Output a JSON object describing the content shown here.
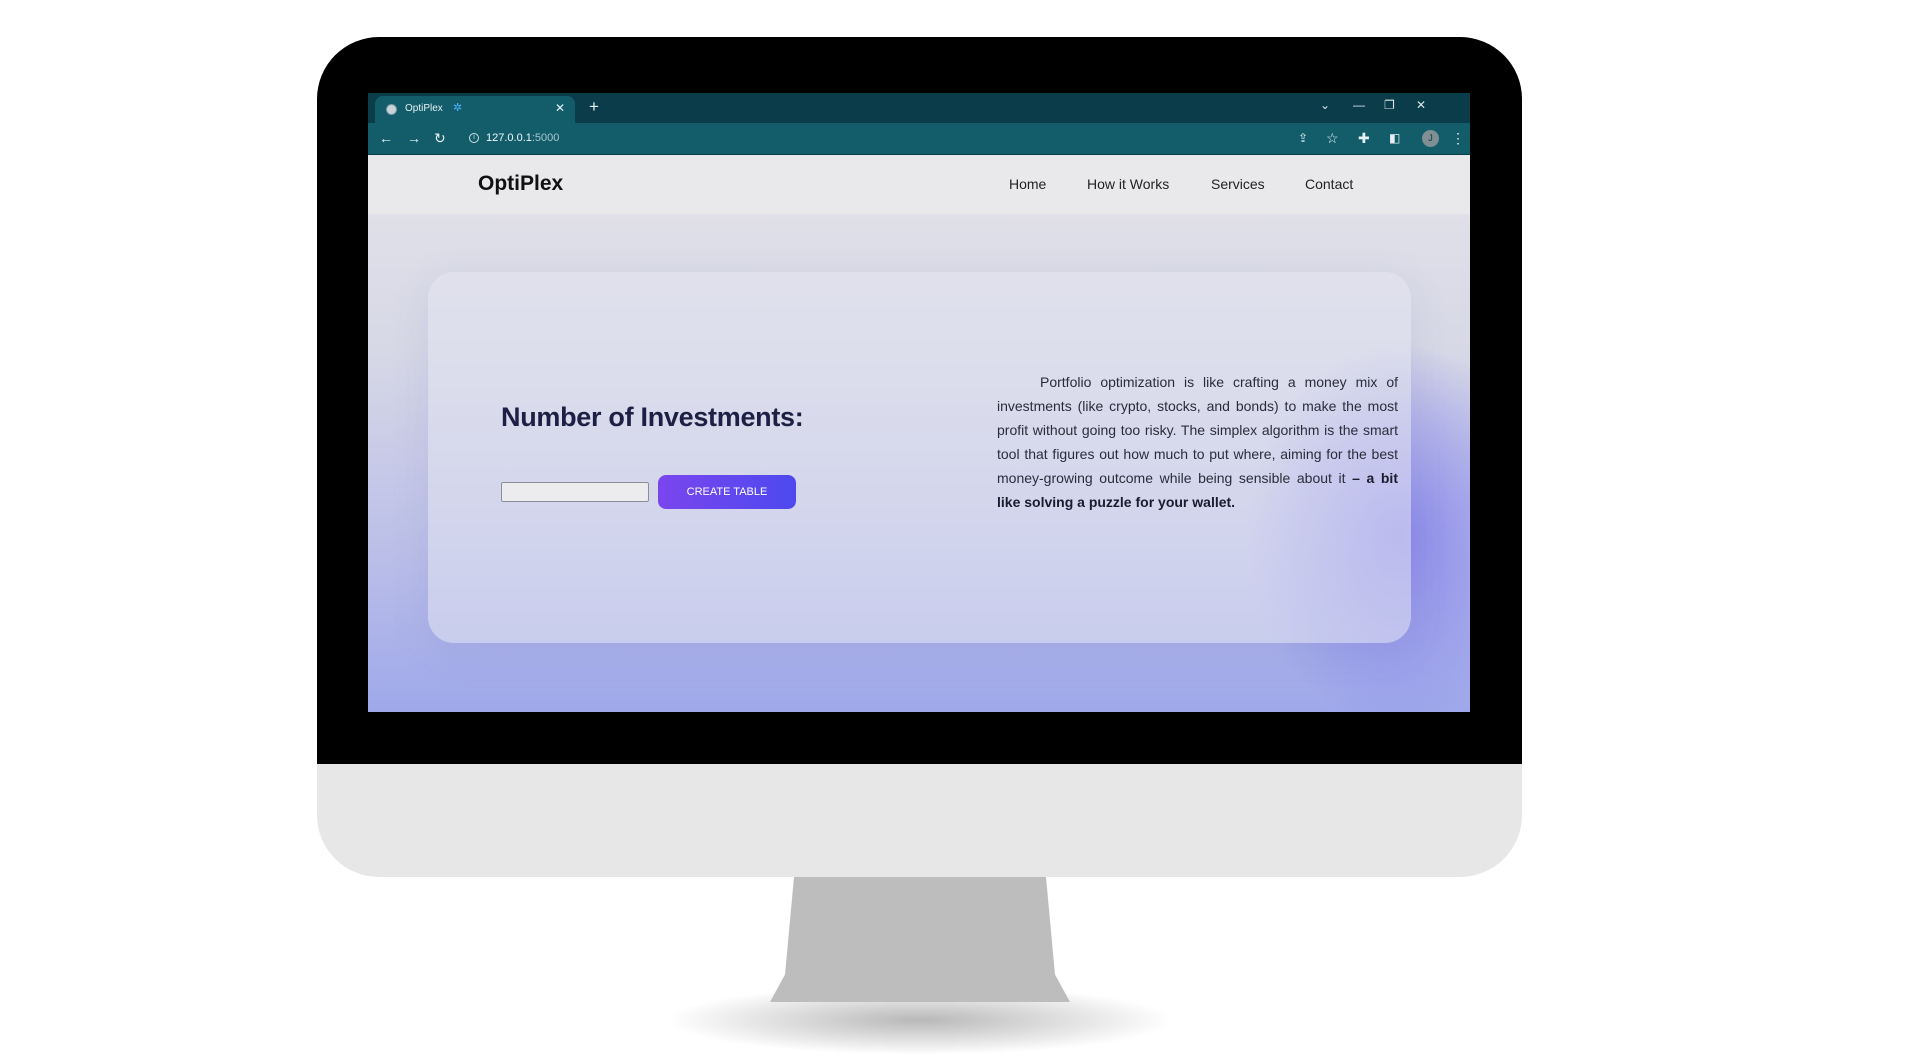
{
  "browser": {
    "tab": {
      "title": "OptiPlex",
      "close_glyph": "✕"
    },
    "new_tab_glyph": "+",
    "window_controls": [
      "⌄",
      "—",
      "❐",
      "✕"
    ],
    "url": {
      "host": "127.0.0.1",
      "port": ":5000"
    },
    "profile_initial": "J",
    "icons": [
      "back-arrow-icon",
      "forward-arrow-icon",
      "reload-icon",
      "site-info-icon",
      "share-icon",
      "bookmark-star-icon",
      "extensions-puzzle-icon",
      "side-panel-icon",
      "kebab-menu-icon"
    ]
  },
  "site": {
    "brand": "OptiPlex",
    "nav": [
      "Home",
      "How it Works",
      "Services",
      "Contact"
    ]
  },
  "main": {
    "heading": "Number of Investments:",
    "input_value": "",
    "button_label": "CREATE TABLE",
    "description": "Portfolio optimization is like crafting a money mix of investments (like crypto, stocks, and bonds) to make the most profit without going too risky. The simplex algorithm is the smart tool that figures out how much to put where, aiming for the best money-growing outcome while being sensible about it",
    "description_emphasis": "– a bit like solving a puzzle for your wallet."
  },
  "colors": {
    "tab_bar": "#0b3c49",
    "toolbar": "#135d6b",
    "button_start": "#7a45ee",
    "button_end": "#4d49ef",
    "heading": "#1d1f44"
  }
}
